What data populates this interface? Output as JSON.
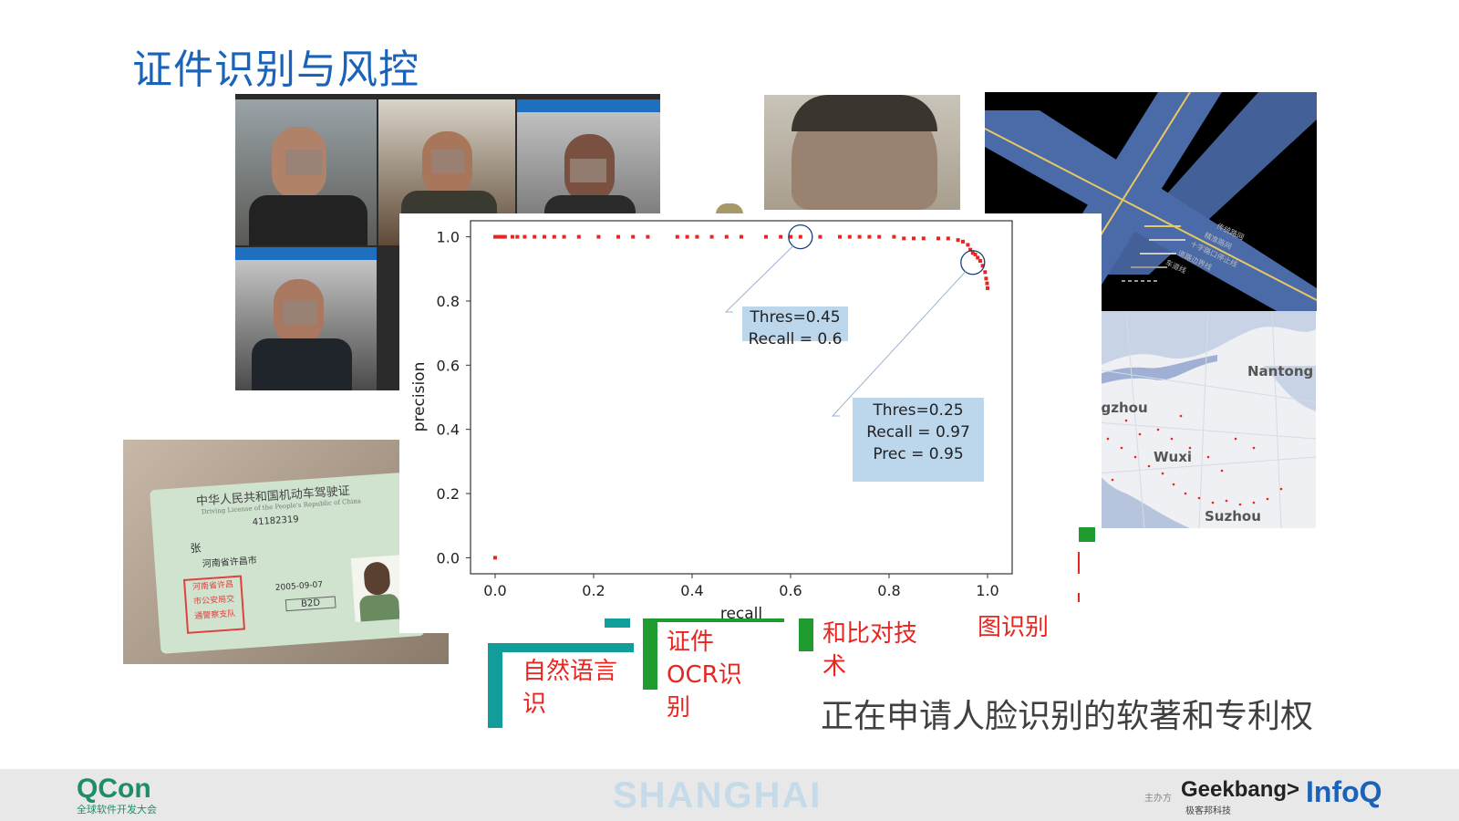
{
  "title": "证件识别与风控",
  "chart_data": {
    "type": "scatter",
    "xlabel": "recall",
    "ylabel": "precision",
    "xlim": [
      -0.05,
      1.05
    ],
    "ylim": [
      -0.05,
      1.05
    ],
    "xticks": [
      "0.0",
      "0.2",
      "0.4",
      "0.6",
      "0.8",
      "1.0"
    ],
    "yticks": [
      "0.0",
      "0.2",
      "0.4",
      "0.6",
      "0.8",
      "1.0"
    ],
    "point_color": "#e8251f",
    "points": [
      [
        0.0,
        0.0
      ],
      [
        0.0,
        1.0
      ],
      [
        0.005,
        1.0
      ],
      [
        0.01,
        1.0
      ],
      [
        0.015,
        1.0
      ],
      [
        0.02,
        1.0
      ],
      [
        0.035,
        1.0
      ],
      [
        0.045,
        1.0
      ],
      [
        0.06,
        1.0
      ],
      [
        0.08,
        1.0
      ],
      [
        0.1,
        1.0
      ],
      [
        0.12,
        1.0
      ],
      [
        0.14,
        1.0
      ],
      [
        0.17,
        1.0
      ],
      [
        0.21,
        1.0
      ],
      [
        0.25,
        1.0
      ],
      [
        0.28,
        1.0
      ],
      [
        0.31,
        1.0
      ],
      [
        0.37,
        1.0
      ],
      [
        0.39,
        1.0
      ],
      [
        0.41,
        1.0
      ],
      [
        0.44,
        1.0
      ],
      [
        0.47,
        1.0
      ],
      [
        0.5,
        1.0
      ],
      [
        0.55,
        1.0
      ],
      [
        0.58,
        1.0
      ],
      [
        0.6,
        1.0
      ],
      [
        0.62,
        1.0
      ],
      [
        0.66,
        1.0
      ],
      [
        0.7,
        1.0
      ],
      [
        0.72,
        1.0
      ],
      [
        0.74,
        1.0
      ],
      [
        0.76,
        1.0
      ],
      [
        0.78,
        1.0
      ],
      [
        0.81,
        1.0
      ],
      [
        0.83,
        0.995
      ],
      [
        0.85,
        0.995
      ],
      [
        0.87,
        0.995
      ],
      [
        0.9,
        0.995
      ],
      [
        0.92,
        0.995
      ],
      [
        0.94,
        0.99
      ],
      [
        0.95,
        0.985
      ],
      [
        0.96,
        0.975
      ],
      [
        0.965,
        0.96
      ],
      [
        0.97,
        0.95
      ],
      [
        0.975,
        0.945
      ],
      [
        0.98,
        0.935
      ],
      [
        0.985,
        0.925
      ],
      [
        0.99,
        0.91
      ],
      [
        0.995,
        0.89
      ],
      [
        0.997,
        0.87
      ],
      [
        0.999,
        0.855
      ],
      [
        1.0,
        0.84
      ]
    ],
    "annotations": [
      {
        "lines": [
          "Thres=0.45",
          "Recall = 0.6"
        ],
        "at": [
          0.62,
          1.0
        ]
      },
      {
        "lines": [
          "Thres=0.25",
          "Recall = 0.97",
          "Prec = 0.95"
        ],
        "at": [
          0.97,
          0.92
        ]
      }
    ]
  },
  "map": {
    "labels": [
      "Nantong",
      "Changzhou",
      "Wuxi",
      "Suzhou"
    ]
  },
  "road_legend": [
    "传统路网",
    "精准路网",
    "十字路口停止线",
    "道路边界线",
    "车道线"
  ],
  "license_card": {
    "title": "中华人民共和国机动车驾驶证",
    "subtitle": "Driving License of the People's Republic of China",
    "number": "41182319",
    "name": "张",
    "address": "河南省许昌市",
    "class": "B2D",
    "issue_date": "2005-09-07",
    "seal": [
      "河南省许昌",
      "市公安局交",
      "通警察支队"
    ]
  },
  "bottom_items": [
    {
      "label_lines": [
        "自然语言",
        "识"
      ],
      "bar_color": "#119e9a"
    },
    {
      "label_lines": [
        "证件",
        "OCR识",
        "别"
      ],
      "bar_color": "#1f9c2f"
    },
    {
      "label_lines": [
        "和比对技",
        "术"
      ],
      "bar_color": "#1f9c2f"
    },
    {
      "label_lines": [
        "图识别"
      ],
      "bar_color": "#1f9c2f"
    }
  ],
  "notice": "正在申请人脸识别的软著和专利权",
  "footer": {
    "qcon": "QCon",
    "qcon_sub": "全球软件开发大会",
    "city": "SHANGHAI",
    "organizer_label": "主办方",
    "geekbang": "Geekbang>",
    "geekbang_sub": "极客邦科技",
    "infoq": "InfoQ"
  }
}
